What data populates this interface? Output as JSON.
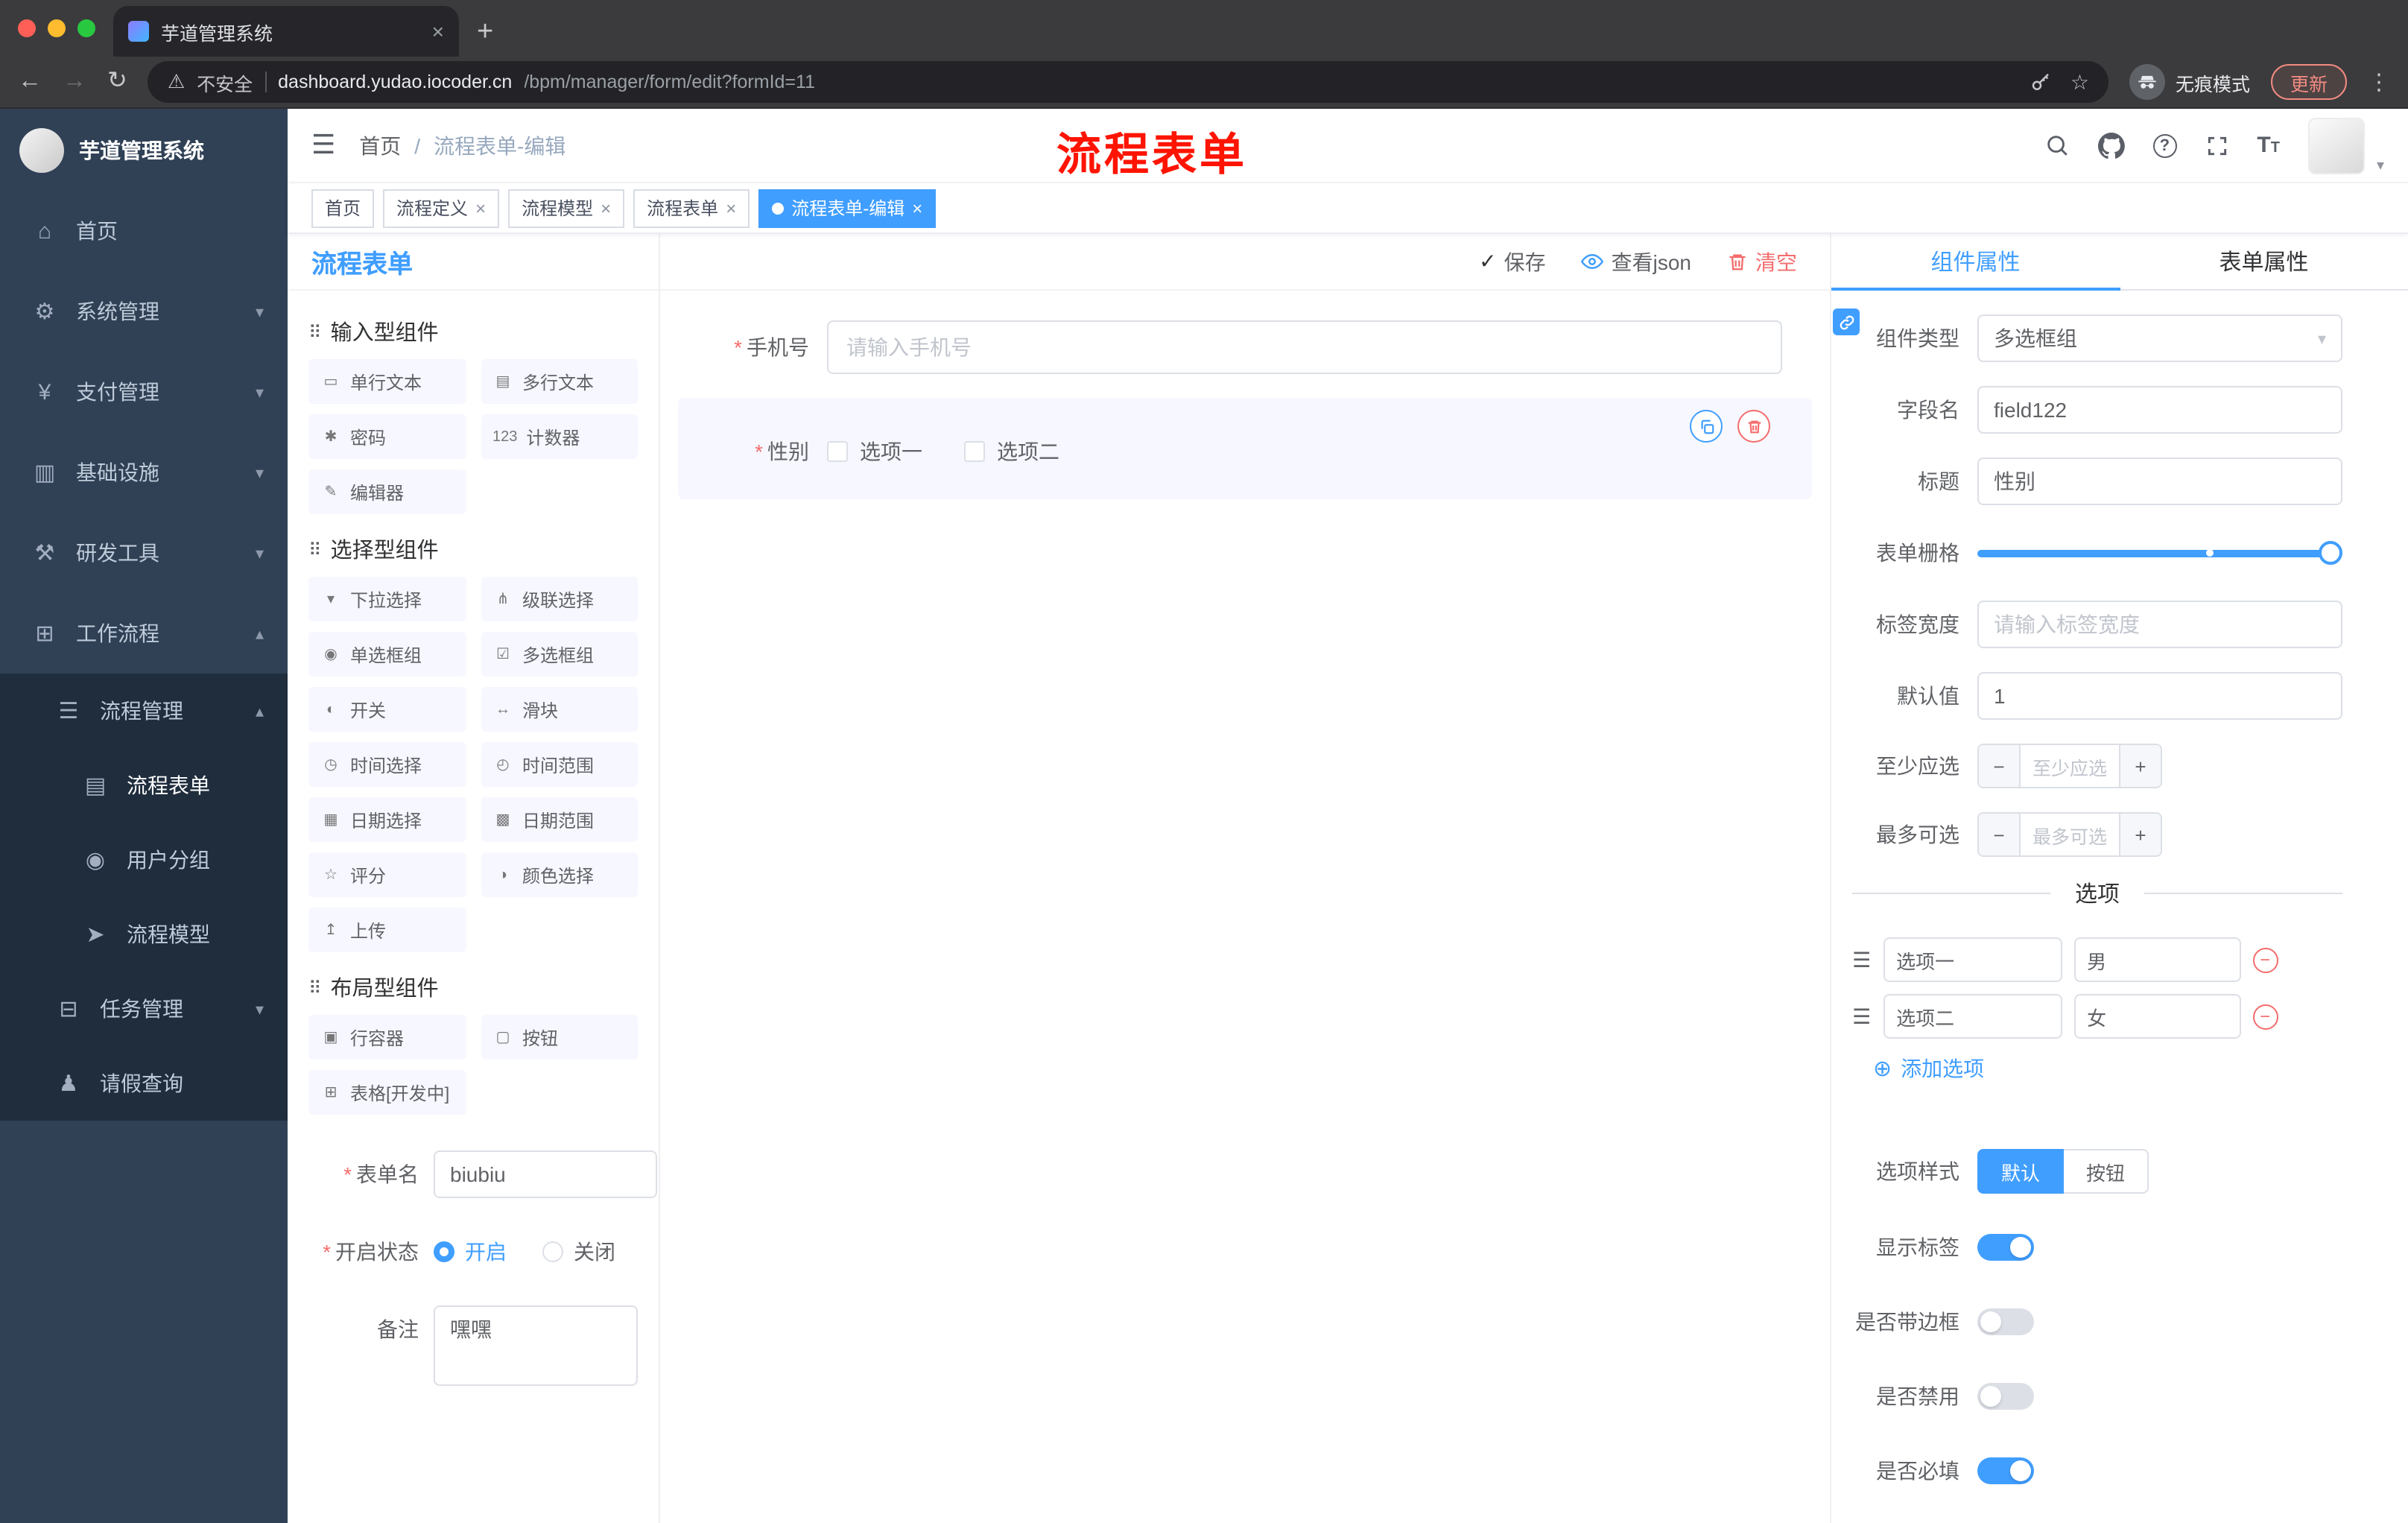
{
  "icons": {
    "close": "×",
    "plus": "+",
    "back": "←",
    "forward": "→",
    "reload": "↻",
    "warning": "⚠",
    "kebab": "⋮",
    "star": "☆",
    "hamburger": "☰",
    "caret_down": "▾",
    "caret_up": "▴",
    "check": "✓",
    "minus": "−",
    "add_circle": "⊕",
    "required": "*",
    "breadcrumb_sep": "/",
    "drag": "☰",
    "question": "?",
    "font_large": "T",
    "font_small": "T"
  },
  "chrome": {
    "tab_title": "芋道管理系统",
    "security_label": "不安全",
    "url_domain": "dashboard.yudao.iocoder.cn",
    "url_path": "/bpm/manager/form/edit?formId=11",
    "incognito_label": "无痕模式",
    "update_label": "更新"
  },
  "sidebar": {
    "logo_title": "芋道管理系统",
    "menu": [
      {
        "icon": "⌂",
        "label": "首页"
      },
      {
        "icon": "⚙",
        "label": "系统管理"
      },
      {
        "icon": "¥",
        "label": "支付管理"
      },
      {
        "icon": "▥",
        "label": "基础设施"
      },
      {
        "icon": "⚒",
        "label": "研发工具"
      },
      {
        "icon": "⊞",
        "label": "工作流程"
      }
    ],
    "submenu": [
      {
        "icon": "☰",
        "label": "流程管理"
      },
      {
        "icon": "▤",
        "label": "流程表单"
      },
      {
        "icon": "◉",
        "label": "用户分组"
      },
      {
        "icon": "➤",
        "label": "流程模型"
      },
      {
        "icon": "⊟",
        "label": "任务管理"
      },
      {
        "icon": "♟",
        "label": "请假查询"
      }
    ]
  },
  "header": {
    "breadcrumb": [
      "首页",
      "流程表单-编辑"
    ],
    "annotation": "流程表单"
  },
  "tags": [
    {
      "label": "首页"
    },
    {
      "label": "流程定义"
    },
    {
      "label": "流程模型"
    },
    {
      "label": "流程表单"
    },
    {
      "label": "流程表单-编辑"
    }
  ],
  "palette": {
    "title": "流程表单",
    "sections": [
      {
        "icon": "⠿",
        "title": "输入型组件",
        "items": [
          {
            "icon": "▭",
            "label": "单行文本"
          },
          {
            "icon": "▤",
            "label": "多行文本"
          },
          {
            "icon": "✱",
            "label": "密码"
          },
          {
            "icon": "123",
            "label": "计数器"
          },
          {
            "icon": "✎",
            "label": "编辑器"
          }
        ]
      },
      {
        "icon": "⠿",
        "title": "选择型组件",
        "items": [
          {
            "icon": "▾",
            "label": "下拉选择"
          },
          {
            "icon": "⋔",
            "label": "级联选择"
          },
          {
            "icon": "◉",
            "label": "单选框组"
          },
          {
            "icon": "☑",
            "label": "多选框组"
          },
          {
            "icon": "◐",
            "label": "开关"
          },
          {
            "icon": "↔",
            "label": "滑块"
          },
          {
            "icon": "◷",
            "label": "时间选择"
          },
          {
            "icon": "◴",
            "label": "时间范围"
          },
          {
            "icon": "▦",
            "label": "日期选择"
          },
          {
            "icon": "▩",
            "label": "日期范围"
          },
          {
            "icon": "☆",
            "label": "评分"
          },
          {
            "icon": "◑",
            "label": "颜色选择"
          },
          {
            "icon": "↥",
            "label": "上传"
          }
        ]
      },
      {
        "icon": "⠿",
        "title": "布局型组件",
        "items": [
          {
            "icon": "▣",
            "label": "行容器"
          },
          {
            "icon": "▢",
            "label": "按钮"
          },
          {
            "icon": "⊞",
            "label": "表格[开发中]"
          }
        ]
      }
    ],
    "form": {
      "name_label": "表单名",
      "name_value": "biubiu",
      "status_label": "开启状态",
      "status_on": "开启",
      "status_off": "关闭",
      "remark_label": "备注",
      "remark_value": "嘿嘿"
    }
  },
  "toolbar": {
    "save": "保存",
    "view_json": "查看json",
    "clear": "清空"
  },
  "canvas": {
    "phone": {
      "label": "手机号",
      "placeholder": "请输入手机号"
    },
    "gender": {
      "label": "性别",
      "options": [
        {
          "label": "选项一"
        },
        {
          "label": "选项二"
        }
      ]
    }
  },
  "inspector": {
    "tabs": [
      {
        "label": "组件属性"
      },
      {
        "label": "表单属性"
      }
    ],
    "component_type": {
      "label": "组件类型",
      "value": "多选框组"
    },
    "field_name": {
      "label": "字段名",
      "value": "field122"
    },
    "title_field": {
      "label": "标题",
      "value": "性别"
    },
    "grid": {
      "label": "表单栅格"
    },
    "label_width": {
      "label": "标签宽度",
      "placeholder": "请输入标签宽度"
    },
    "default_value": {
      "label": "默认值",
      "value": "1"
    },
    "min_select": {
      "label": "至少应选",
      "placeholder": "至少应选"
    },
    "max_select": {
      "label": "最多可选",
      "placeholder": "最多可选"
    },
    "options": {
      "divider": "选项",
      "rows": [
        {
          "name": "选项一",
          "value": "男"
        },
        {
          "name": "选项二",
          "value": "女"
        }
      ],
      "add_label": "添加选项"
    },
    "style": {
      "label": "选项样式",
      "default_btn": "默认",
      "button_btn": "按钮"
    },
    "switches": [
      {
        "label": "显示标签",
        "on": true
      },
      {
        "label": "是否带边框",
        "on": false
      },
      {
        "label": "是否禁用",
        "on": false
      },
      {
        "label": "是否必填",
        "on": true
      }
    ]
  },
  "colors": {
    "primary": "#409EFF",
    "danger": "#F56C6C",
    "annotation": "#FE1400"
  }
}
